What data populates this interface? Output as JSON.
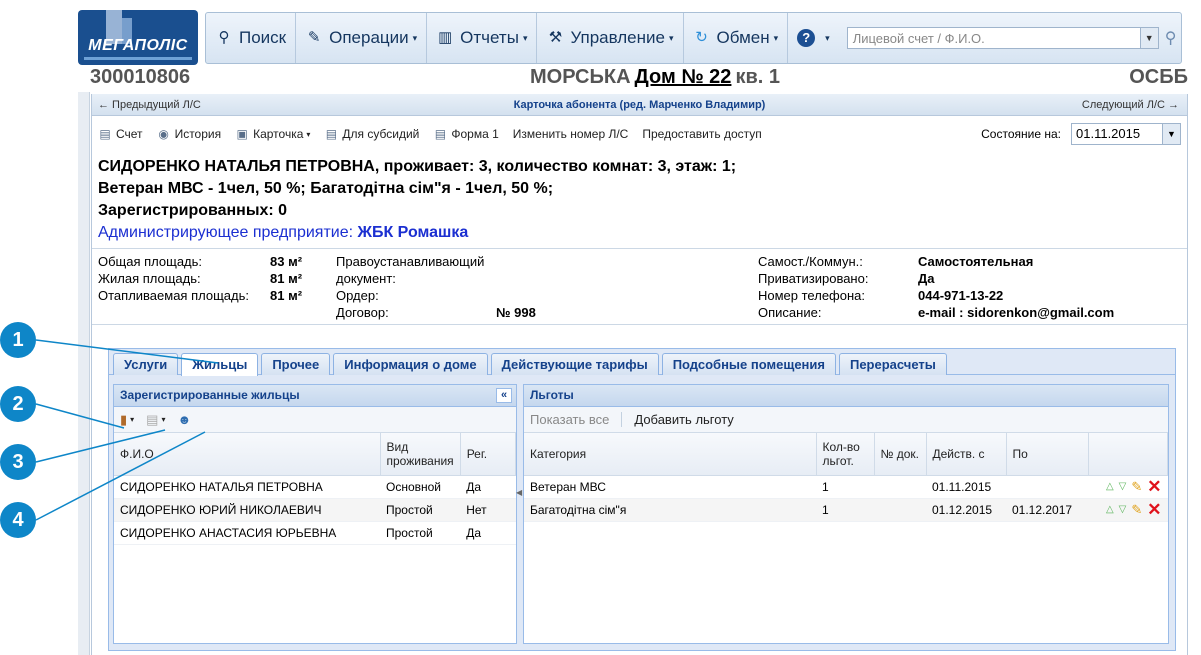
{
  "logo": {
    "text": "МЕГАПОЛІС"
  },
  "toolbar": {
    "search": "Поиск",
    "operations": "Операции",
    "reports": "Отчеты",
    "management": "Управление",
    "exchange": "Обмен",
    "help_icon": "help-icon",
    "search_placeholder": "Лицевой счет / Ф.И.О."
  },
  "header": {
    "account": "300010806",
    "street": "МОРСЬКА",
    "house": "Дом № 22",
    "flat": "кв. 1",
    "org": "ОСББ"
  },
  "card_nav": {
    "prev": "← Предыдущий Л/С",
    "title": "Карточка абонента (ред. Марченко Владимир)",
    "next": "Следующий Л/С →"
  },
  "card_tools": {
    "account": "Счет",
    "history": "История",
    "card": "Карточка",
    "subsidies": "Для субсидий",
    "form1": "Форма 1",
    "change_number": "Изменить номер Л/С",
    "grant_access": "Предоставить доступ",
    "state_label": "Состояние на:",
    "state_date": "01.11.2015"
  },
  "subscriber": {
    "line1": "СИДОРЕНКО НАТАЛЬЯ ПЕТРОВНА, проживает: 3, количество комнат: 3, этаж: 1;",
    "line2": "Ветеран МВС - 1чел, 50 %; Багатодітна сім\"я - 1чел, 50 %;",
    "line3": "Зарегистрированных: 0",
    "admin_label": "Администрирующее предприятие:",
    "admin_value": "ЖБК Ромашка"
  },
  "details": {
    "total_area_label": "Общая площадь:",
    "total_area": "83 м²",
    "living_area_label": "Жилая площадь:",
    "living_area": "81 м²",
    "heated_area_label": "Отапливаемая площадь:",
    "heated_area": "81 м²",
    "doc_label1": "Правоустанавливающий",
    "doc_label2": "документ:",
    "order_label": "Ордер:",
    "contract_label": "Договор:",
    "contract": "№ 998",
    "self_label": "Самост./Коммун.:",
    "self_value": "Самостоятельная",
    "priv_label": "Приватизировано:",
    "priv_value": "Да",
    "phone_label": "Номер телефона:",
    "phone_value": "044-971-13-22",
    "desc_label": "Описание:",
    "desc_value": "e-mail : sidorenkon@gmail.com"
  },
  "tabs": [
    "Услуги",
    "Жильцы",
    "Прочее",
    "Информация о доме",
    "Действующие тарифы",
    "Подсобные помещения",
    "Перерасчеты"
  ],
  "residents": {
    "title": "Зарегистрированные жильцы",
    "headers": {
      "name": "Ф.И.О",
      "type": "Вид проживания",
      "reg": "Рег."
    },
    "rows": [
      {
        "name": "СИДОРЕНКО НАТАЛЬЯ ПЕТРОВНА",
        "type": "Основной",
        "reg": "Да"
      },
      {
        "name": "СИДОРЕНКО ЮРИЙ НИКОЛАЕВИЧ",
        "type": "Простой",
        "reg": "Нет"
      },
      {
        "name": "СИДОРЕНКО АНАСТАСИЯ ЮРЬЕВНА",
        "type": "Простой",
        "reg": "Да"
      }
    ]
  },
  "benefits": {
    "title": "Льготы",
    "show_all": "Показать все",
    "add": "Добавить льготу",
    "headers": {
      "category": "Категория",
      "count": "Кол-во льгот.",
      "doc": "№ док.",
      "from": "Действ. с",
      "to": "По"
    },
    "rows": [
      {
        "category": "Ветеран МВС",
        "count": "1",
        "doc": "",
        "from": "01.11.2015",
        "to": ""
      },
      {
        "category": "Багатодітна сім\"я",
        "count": "1",
        "doc": "",
        "from": "01.12.2015",
        "to": "01.12.2017"
      }
    ]
  },
  "callouts": [
    "1",
    "2",
    "3",
    "4"
  ]
}
